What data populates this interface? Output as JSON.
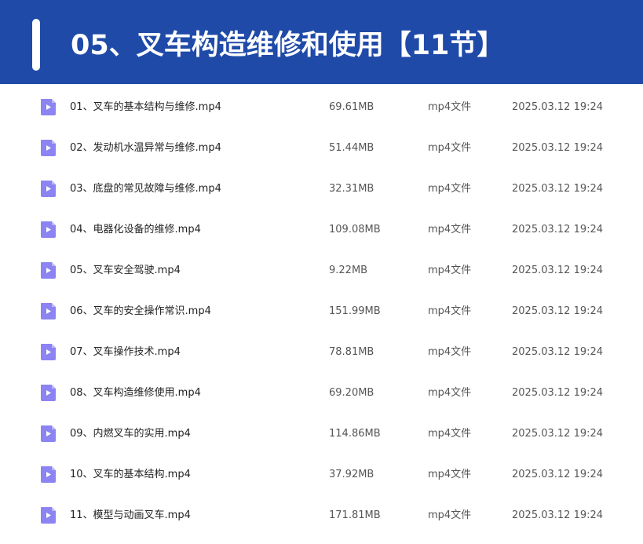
{
  "header": {
    "title": "05、叉车构造维修和使用【11节】"
  },
  "colors": {
    "header_bg": "#1f4aa8",
    "icon_accent": "#8b84f2"
  },
  "file_icon": "video-file-icon",
  "files": [
    {
      "name": "01、叉车的基本结构与维修.mp4",
      "size": "69.61MB",
      "type": "mp4文件",
      "date": "2025.03.12 19:24"
    },
    {
      "name": "02、发动机水温异常与维修.mp4",
      "size": "51.44MB",
      "type": "mp4文件",
      "date": "2025.03.12 19:24"
    },
    {
      "name": "03、底盘的常见故障与维修.mp4",
      "size": "32.31MB",
      "type": "mp4文件",
      "date": "2025.03.12 19:24"
    },
    {
      "name": "04、电器化设备的维修.mp4",
      "size": "109.08MB",
      "type": "mp4文件",
      "date": "2025.03.12 19:24"
    },
    {
      "name": "05、叉车安全驾驶.mp4",
      "size": "9.22MB",
      "type": "mp4文件",
      "date": "2025.03.12 19:24"
    },
    {
      "name": "06、叉车的安全操作常识.mp4",
      "size": "151.99MB",
      "type": "mp4文件",
      "date": "2025.03.12 19:24"
    },
    {
      "name": "07、叉车操作技术.mp4",
      "size": "78.81MB",
      "type": "mp4文件",
      "date": "2025.03.12 19:24"
    },
    {
      "name": "08、叉车构造维修使用.mp4",
      "size": "69.20MB",
      "type": "mp4文件",
      "date": "2025.03.12 19:24"
    },
    {
      "name": "09、内燃叉车的实用.mp4",
      "size": "114.86MB",
      "type": "mp4文件",
      "date": "2025.03.12 19:24"
    },
    {
      "name": "10、叉车的基本结构.mp4",
      "size": "37.92MB",
      "type": "mp4文件",
      "date": "2025.03.12 19:24"
    },
    {
      "name": "11、模型与动画叉车.mp4",
      "size": "171.81MB",
      "type": "mp4文件",
      "date": "2025.03.12 19:24"
    }
  ]
}
